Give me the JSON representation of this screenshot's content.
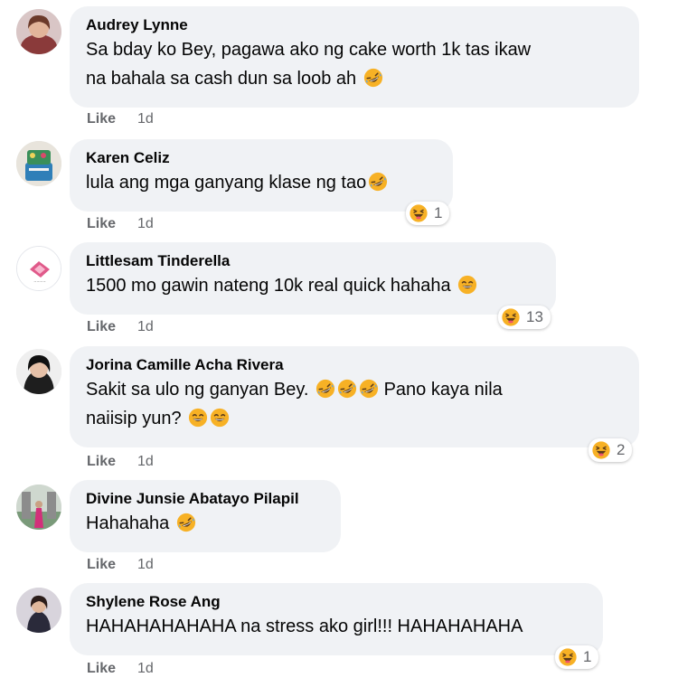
{
  "comments": [
    {
      "author": "Audrey Lynne",
      "text_line1": "Sa bday ko Bey, pagawa ako ng cake worth 1k tas ikaw",
      "text_line2": "na bahala sa cash dun sa loob ah",
      "like": "Like",
      "time": "1d"
    },
    {
      "author": "Karen Celiz",
      "text_line1": "lula ang mga ganyang klase ng tao",
      "like": "Like",
      "time": "1d",
      "reaction_count": "1"
    },
    {
      "author": "Littlesam Tinderella",
      "text_line1": "1500 mo gawin nateng 10k real quick hahaha",
      "like": "Like",
      "time": "1d",
      "reaction_count": "13"
    },
    {
      "author": "Jorina Camille Acha Rivera",
      "text_line1": "Sakit sa ulo ng ganyan Bey.",
      "text_line1b": "Pano kaya nila",
      "text_line2": "naiisip yun?",
      "like": "Like",
      "time": "1d",
      "reaction_count": "2"
    },
    {
      "author": "Divine Junsie Abatayo Pilapil",
      "text_line1": "Hahahaha",
      "like": "Like",
      "time": "1d"
    },
    {
      "author": "Shylene Rose Ang",
      "text_line1": "HAHAHAHAHAHA na stress ako girl!!! HAHAHAHAHA",
      "like": "Like",
      "time": "1d",
      "reaction_count": "1"
    }
  ],
  "icons": {
    "laugh_emoji": "rolling-on-floor-laughing-emoji",
    "grin_emoji": "grinning-squinting-emoji",
    "haha_reaction": "haha-reaction-icon"
  },
  "colors": {
    "bubble_bg": "#f0f2f5",
    "meta_text": "#65676b",
    "emoji_yellow": "#f7b125"
  }
}
